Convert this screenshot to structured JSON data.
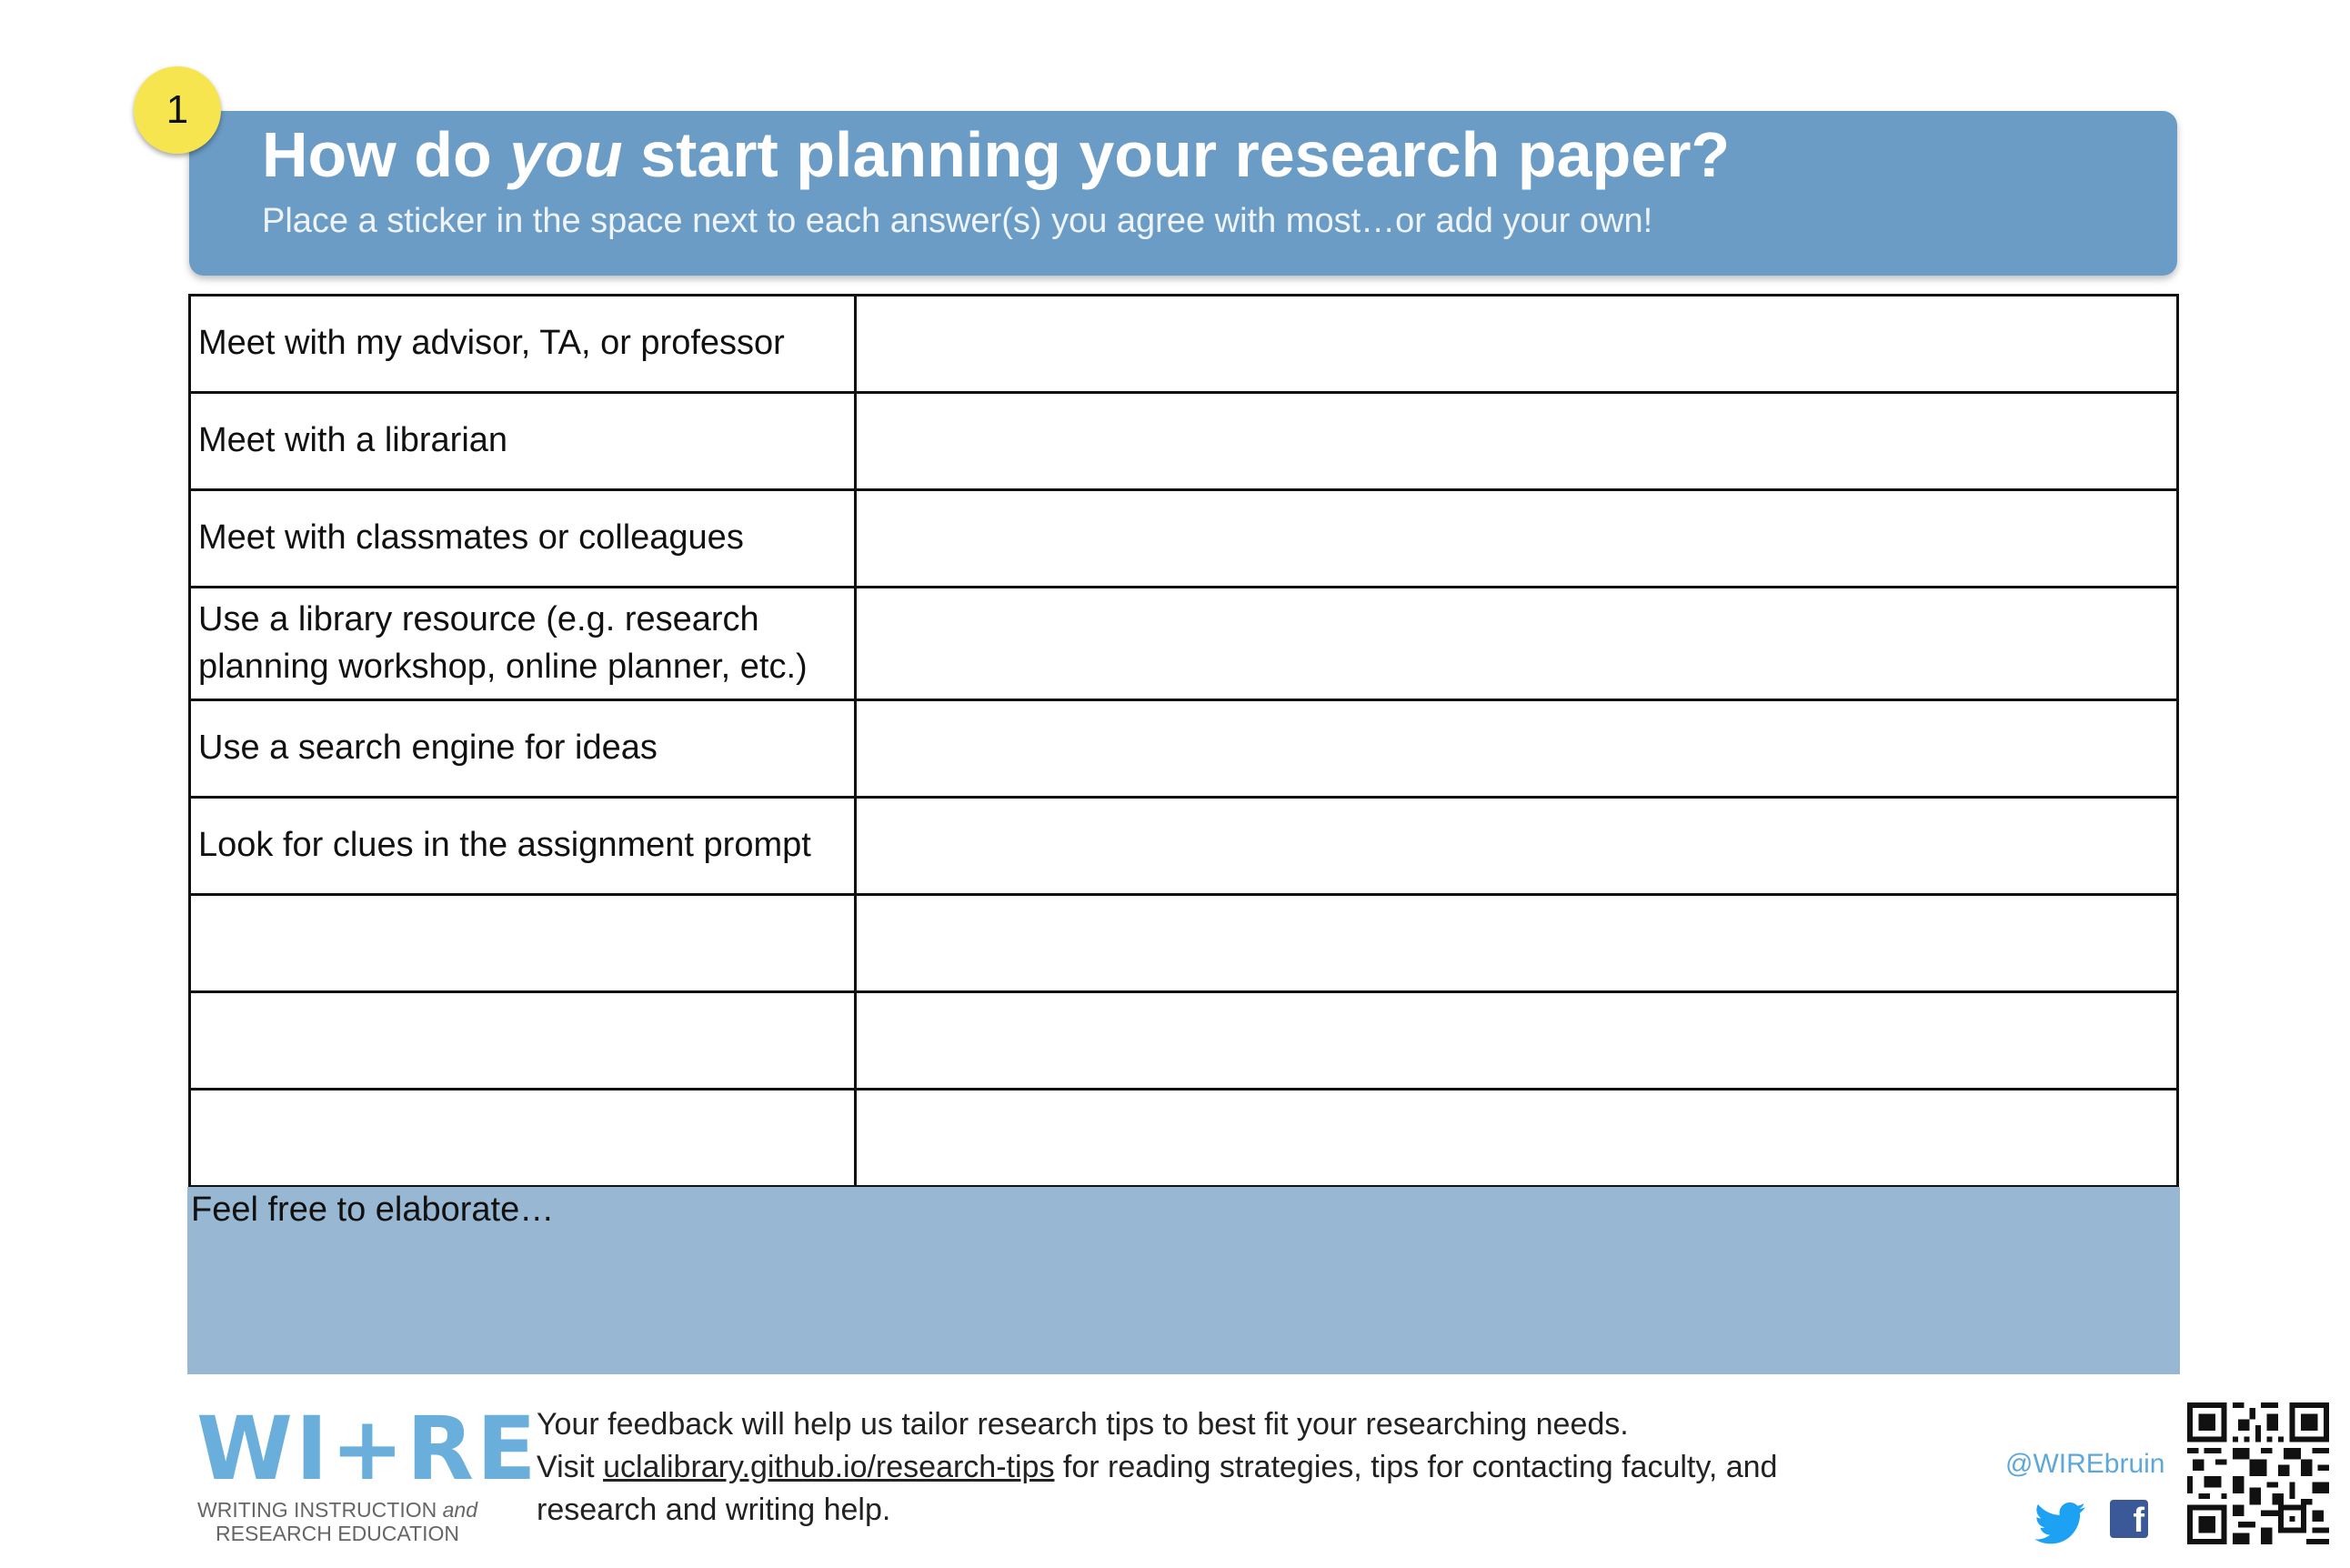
{
  "badge": {
    "number": "1"
  },
  "header": {
    "title_before": "How do ",
    "title_emphasis": "you",
    "title_after": " start planning your research paper?",
    "subtitle": "Place a sticker in the space next to each answer(s) you agree with most…or add your own!"
  },
  "answers": [
    {
      "label": "Meet with my advisor, TA, or professor",
      "sticker": ""
    },
    {
      "label": "Meet with a librarian",
      "sticker": ""
    },
    {
      "label": "Meet with classmates or colleagues",
      "sticker": ""
    },
    {
      "label": "Use a library resource (e.g. research planning workshop, online planner, etc.)",
      "sticker": ""
    },
    {
      "label": "Use a search engine for ideas",
      "sticker": ""
    },
    {
      "label": "Look for clues in the assignment prompt",
      "sticker": ""
    },
    {
      "label": "",
      "sticker": ""
    },
    {
      "label": "",
      "sticker": ""
    },
    {
      "label": "",
      "sticker": ""
    }
  ],
  "elaborate": {
    "label": "Feel free to elaborate…"
  },
  "logo": {
    "wordmark": "WI+RE",
    "line1_before": "WRITING INSTRUCTION ",
    "line1_emphasis": "and",
    "line2": "RESEARCH EDUCATION"
  },
  "footer": {
    "line1": "Your feedback will help us tailor research tips to best fit your researching needs.",
    "visit_prefix": "Visit ",
    "link_text": "uclalibrary.github.io/research-tips",
    "visit_suffix": " for reading strategies, tips for contacting faculty, and research and writing help."
  },
  "social": {
    "handle": "@WIREbruin",
    "icons": [
      "twitter-icon",
      "facebook-icon"
    ],
    "facebook_glyph": "f"
  },
  "colors": {
    "banner": "#6b9cc5",
    "badge": "#f7e54f",
    "elaborate_panel": "#97b7d2",
    "logo": "#6aaedc",
    "handle": "#5ea8d8"
  }
}
